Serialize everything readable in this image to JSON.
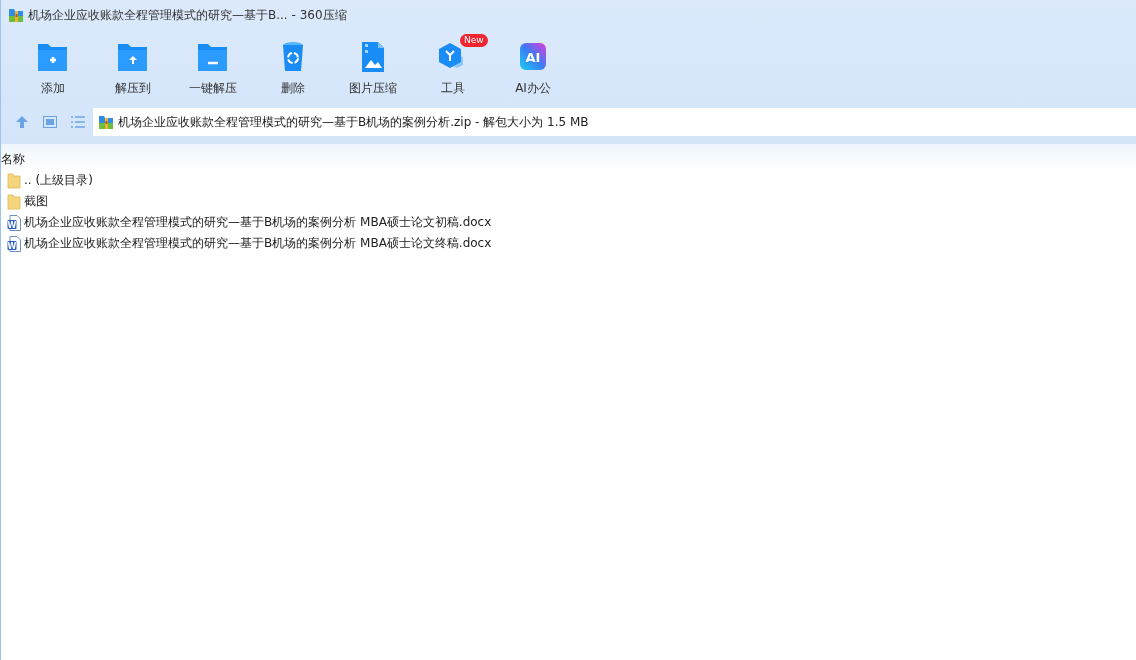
{
  "window": {
    "title": "机场企业应收账款全程管理模式的研究—基于B... - 360压缩"
  },
  "toolbar": [
    {
      "kind": "add",
      "label": "添加"
    },
    {
      "kind": "extract",
      "label": "解压到"
    },
    {
      "kind": "quick",
      "label": "一键解压"
    },
    {
      "kind": "delete",
      "label": "删除"
    },
    {
      "kind": "image",
      "label": "图片压缩"
    },
    {
      "kind": "tools",
      "label": "工具",
      "badge": "New"
    },
    {
      "kind": "ai",
      "label": "AI办公",
      "icon_text": "AI"
    }
  ],
  "address": {
    "path": "机场企业应收账款全程管理模式的研究—基于B机场的案例分析.zip - 解包大小为 1.5 MB"
  },
  "table": {
    "columns": [
      "名称"
    ],
    "rows": [
      {
        "kind": "folder",
        "name": ".. (上级目录)"
      },
      {
        "kind": "folder",
        "name": "截图"
      },
      {
        "kind": "docx",
        "name": "机场企业应收账款全程管理模式的研究—基于B机场的案例分析 MBA硕士论文初稿.docx",
        "icon_text": "W"
      },
      {
        "kind": "docx",
        "name": "机场企业应收账款全程管理模式的研究—基于B机场的案例分析 MBA硕士论文终稿.docx",
        "icon_text": "W"
      }
    ]
  }
}
